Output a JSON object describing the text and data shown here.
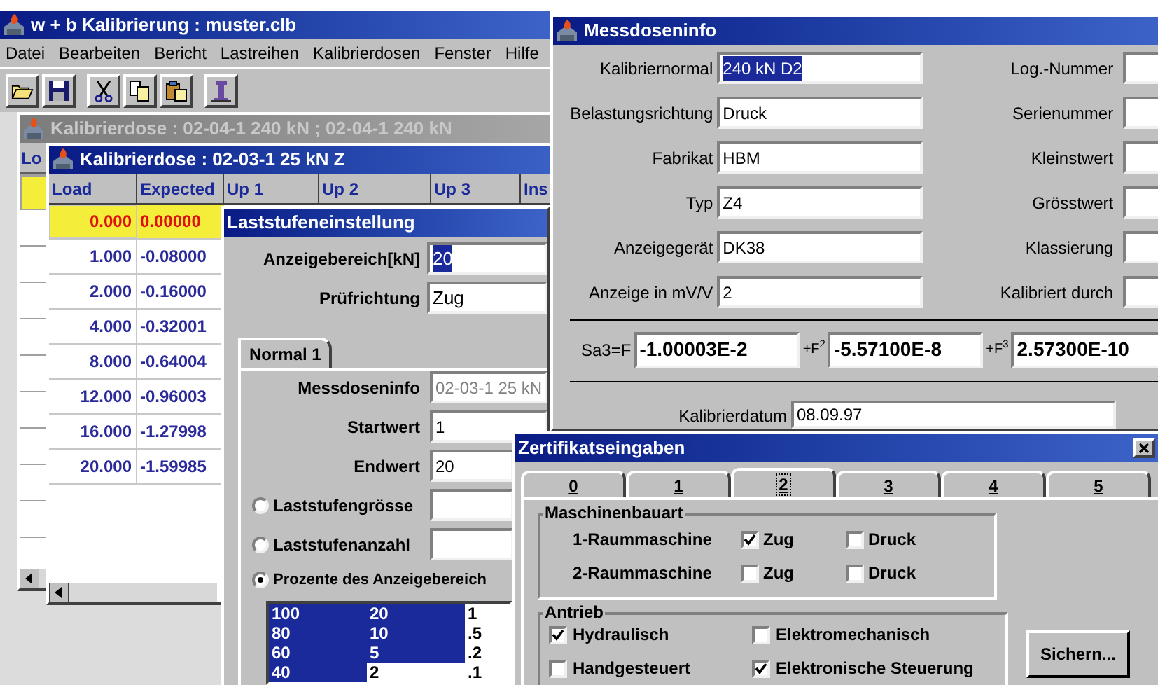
{
  "main_window": {
    "title": "w + b Kalibrierung : muster.clb",
    "active": true,
    "menu": [
      "Datei",
      "Bearbeiten",
      "Bericht",
      "Lastreihen",
      "Kalibrierdosen",
      "Fenster",
      "Hilfe"
    ]
  },
  "back_document": {
    "title": "Kalibrierdose : 02-04-1 240 kN ; 02-04-1 240 kN",
    "active": false,
    "column_1": "Lo",
    "rows": [
      {
        "selected": true
      },
      {
        "selected": false
      },
      {
        "selected": false
      },
      {
        "selected": false
      },
      {
        "selected": false
      },
      {
        "selected": false
      },
      {
        "selected": false
      },
      {
        "selected": false
      },
      {
        "selected": false
      },
      {
        "selected": false
      }
    ]
  },
  "document": {
    "title": "Kalibrierdose : 02-03-1 25 kN Z",
    "active": true,
    "columns": [
      "Load",
      "Expected",
      "Up 1",
      "Up 2",
      "Up 3",
      "Ins"
    ],
    "rows": [
      {
        "load": "0.000",
        "expected": "0.00000",
        "selected": true
      },
      {
        "load": "1.000",
        "expected": "-0.08000",
        "selected": false
      },
      {
        "load": "2.000",
        "expected": "-0.16000",
        "selected": false
      },
      {
        "load": "4.000",
        "expected": "-0.32001",
        "selected": false
      },
      {
        "load": "8.000",
        "expected": "-0.64004",
        "selected": false
      },
      {
        "load": "12.000",
        "expected": "-0.96003",
        "selected": false
      },
      {
        "load": "16.000",
        "expected": "-1.27998",
        "selected": false
      },
      {
        "load": "20.000",
        "expected": "-1.59985",
        "selected": false
      }
    ]
  },
  "load_step_dialog": {
    "title": "Laststufeneinstellung",
    "active": true,
    "fields": [
      {
        "label": "Anzeigebereich[kN]",
        "value": "20",
        "selected": true
      },
      {
        "label": "Prüfrichtung",
        "value": "Zug",
        "selected": false
      }
    ],
    "tab": "Normal 1",
    "tab_fields": [
      {
        "label": "Messdoseninfo",
        "value": "02-03-1 25 kN",
        "disabled": true
      },
      {
        "label": "Startwert",
        "value": "1",
        "disabled": false
      },
      {
        "label": "Endwert",
        "value": "20",
        "disabled": false
      }
    ],
    "options": [
      {
        "label": "Laststufengrösse",
        "selected": false,
        "kind": "input"
      },
      {
        "label": "Laststufenanzahl",
        "selected": false,
        "kind": "input"
      },
      {
        "label": "Prozente des Anzeigebereich",
        "selected": true,
        "kind": "plain"
      }
    ],
    "percent_list": [
      {
        "cells": [
          {
            "text": "100",
            "selected": true
          },
          {
            "text": "20",
            "selected": true
          },
          {
            "text": "1",
            "selected": false
          }
        ]
      },
      {
        "cells": [
          {
            "text": "80",
            "selected": true
          },
          {
            "text": "10",
            "selected": true
          },
          {
            "text": ".5",
            "selected": false
          }
        ]
      },
      {
        "cells": [
          {
            "text": "60",
            "selected": true
          },
          {
            "text": "5",
            "selected": true
          },
          {
            "text": ".2",
            "selected": false
          }
        ]
      },
      {
        "cells": [
          {
            "text": "40",
            "selected": true
          },
          {
            "text": "2",
            "selected": false
          },
          {
            "text": ".1",
            "selected": false
          }
        ]
      }
    ]
  },
  "sensor_info": {
    "title": "Messdoseninfo",
    "active": true,
    "fields": [
      {
        "label": "Kalibriernormal",
        "value": "240 kN D2",
        "selected": true
      },
      {
        "label": "Belastungsrichtung",
        "value": "Druck",
        "selected": false
      },
      {
        "label": "Fabrikat",
        "value": "HBM",
        "selected": false
      },
      {
        "label": "Typ",
        "value": "Z4",
        "selected": false
      },
      {
        "label": "Anzeigegerät",
        "value": "DK38",
        "selected": false
      },
      {
        "label": "Anzeige in mV/V",
        "value": "2",
        "selected": false
      }
    ],
    "right_labels": [
      "Log.-Nummer",
      "Serienummer",
      "Kleinstwert",
      "Grösstwert",
      "Klassierung",
      "Kalibriert durch"
    ],
    "formula": {
      "prefix": "Sa3=F",
      "terms": [
        {
          "value": "-1.00003E-2"
        },
        {
          "operator": "+F",
          "power": "2",
          "value": "-5.57100E-8"
        },
        {
          "operator": "+F",
          "power": "3",
          "value": "2.57300E-10"
        }
      ]
    },
    "calibration_date": {
      "label": "Kalibrierdatum",
      "value": "08.09.97"
    }
  },
  "certificate_dialog": {
    "title": "Zertifikatseingaben",
    "active": true,
    "tabs": [
      {
        "label": "0",
        "selected": false
      },
      {
        "label": "1",
        "selected": false
      },
      {
        "label": "2",
        "selected": true
      },
      {
        "label": "3",
        "selected": false
      },
      {
        "label": "4",
        "selected": false
      },
      {
        "label": "5",
        "selected": false
      }
    ],
    "machine_type": {
      "title": "Maschinenbauart",
      "rows": [
        {
          "label": "1-Raummaschine",
          "options": [
            {
              "label": "Zug",
              "checked": true
            },
            {
              "label": "Druck",
              "checked": false
            }
          ]
        },
        {
          "label": "2-Raummaschine",
          "options": [
            {
              "label": "Zug",
              "checked": false
            },
            {
              "label": "Druck",
              "checked": false
            }
          ]
        }
      ]
    },
    "drive": {
      "title": "Antrieb",
      "options": [
        {
          "label": "Hydraulisch",
          "checked": true
        },
        {
          "label": "Elektromechanisch",
          "checked": false
        },
        {
          "label": "Handgesteuert",
          "checked": false
        },
        {
          "label": "Elektronische Steuerung",
          "checked": true
        }
      ]
    },
    "button": "Sichern..."
  }
}
